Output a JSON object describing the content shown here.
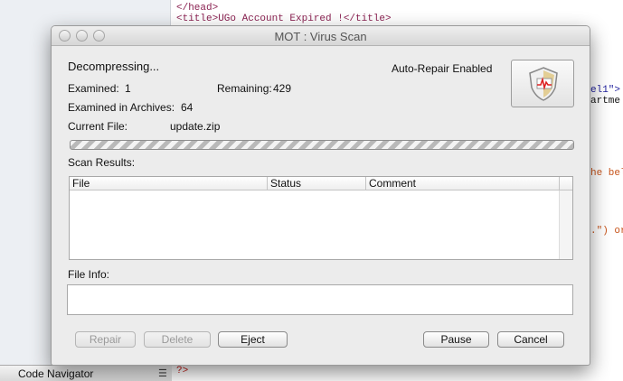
{
  "background": {
    "code_lines": [
      "</head>",
      "<title>UGo Account Expired !</title>",
      "el1\">",
      "artme",
      "he bel",
      ".\") or",
      "?>"
    ],
    "code_navigator_label": "Code Navigator",
    "code_navigator_menu_icon": "list-icon"
  },
  "dialog": {
    "title": "MOT : Virus Scan",
    "status": "Decompressing...",
    "auto_repair": "Auto-Repair Enabled",
    "examined_label": "Examined:",
    "examined_value": "1",
    "remaining_label": "Remaining:",
    "remaining_value": "429",
    "examined_archives_label": "Examined in Archives:",
    "examined_archives_value": "64",
    "current_file_label": "Current File:",
    "current_file_value": "update.zip",
    "scan_results_label": "Scan Results:",
    "columns": [
      "File",
      "Status",
      "Comment"
    ],
    "rows": [],
    "file_info_label": "File Info:",
    "file_info_value": "",
    "buttons": {
      "repair": "Repair",
      "delete": "Delete",
      "eject": "Eject",
      "pause": "Pause",
      "cancel": "Cancel"
    },
    "progress_state": "indeterminate",
    "icon": "antivirus-shield-icon"
  }
}
